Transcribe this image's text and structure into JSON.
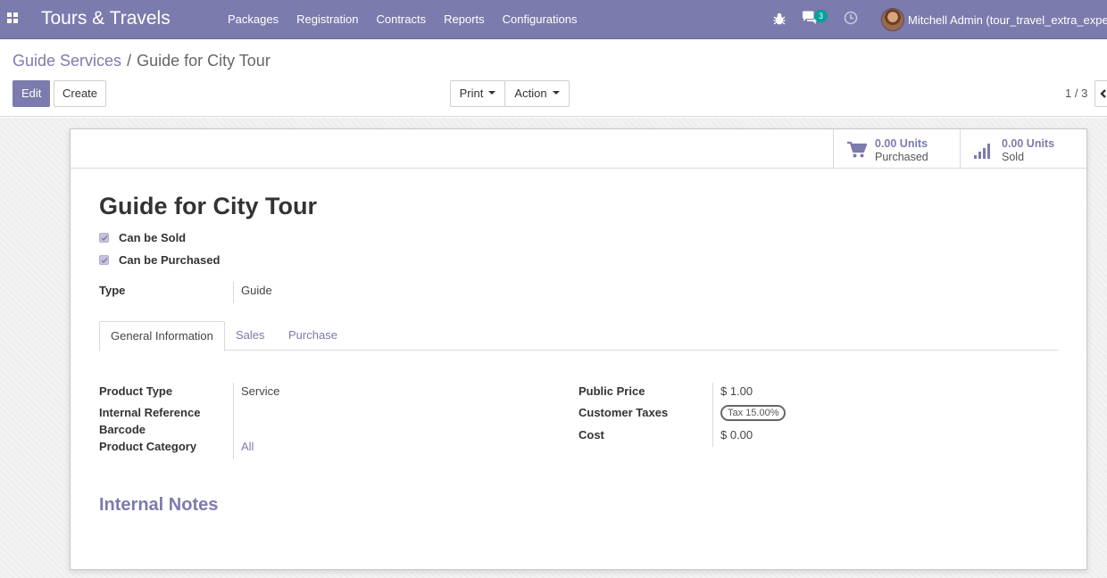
{
  "navbar": {
    "brand": "Tours & Travels",
    "menu": [
      "Packages",
      "Registration",
      "Contracts",
      "Reports",
      "Configurations"
    ],
    "chat_count": "3",
    "user_name": "Mitchell Admin (tour_travel_extra_expe"
  },
  "breadcrumb": {
    "parent": "Guide Services",
    "separator": "/",
    "current": "Guide for City Tour"
  },
  "buttons": {
    "edit": "Edit",
    "create": "Create",
    "print": "Print",
    "action": "Action"
  },
  "pager": {
    "value": "1 / 3"
  },
  "stats": [
    {
      "value": "0.00 Units",
      "label": "Purchased",
      "icon": "cart-icon"
    },
    {
      "value": "0.00 Units",
      "label": "Sold",
      "icon": "signal-icon"
    }
  ],
  "record": {
    "title": "Guide for City Tour",
    "can_be_sold": {
      "label": "Can be Sold",
      "checked": true
    },
    "can_be_purchased": {
      "label": "Can be Purchased",
      "checked": true
    },
    "type": {
      "label": "Type",
      "value": "Guide"
    }
  },
  "tabs": [
    "General Information",
    "Sales",
    "Purchase"
  ],
  "general": {
    "left": [
      {
        "label": "Product Type",
        "value": "Service"
      },
      {
        "label": "Internal Reference",
        "value": ""
      },
      {
        "label": "Barcode",
        "value": ""
      },
      {
        "label": "Product Category",
        "value": "All"
      }
    ],
    "right": [
      {
        "label": "Public Price",
        "value": "$ 1.00"
      },
      {
        "label": "Customer Taxes",
        "value": "Tax 15.00%"
      },
      {
        "label": "Cost",
        "value": "$ 0.00"
      }
    ]
  },
  "notes": {
    "title": "Internal Notes"
  },
  "colors": {
    "brand": "#7c7bad",
    "badge": "#00a09d"
  }
}
